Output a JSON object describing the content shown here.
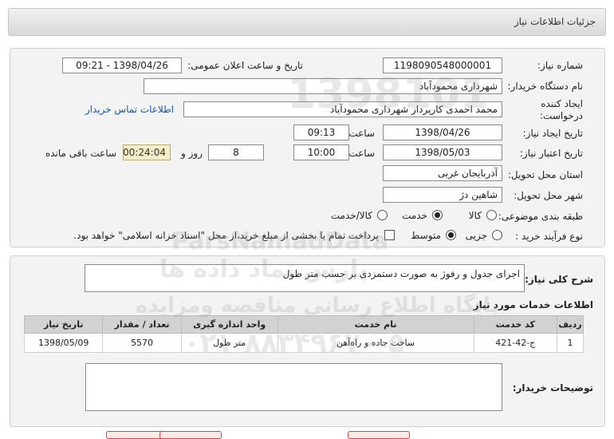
{
  "page": {
    "title": "جزئیات اطلاعات نیاز"
  },
  "form": {
    "need_number_label": "شماره نیاز:",
    "need_number": "1198090548000001",
    "announce_label": "تاریخ و ساعت اعلان عمومی:",
    "announce_value": "1398/04/26 - 09:21",
    "buyer_org_label": "نام دستگاه خریدار:",
    "buyer_org": "شهرداری محمودآباد",
    "creator_label": "ایجاد کننده درخواست:",
    "creator": "محمد احمدی کارپرداز شهرداری محمودآباد",
    "contact_link": "اطلاعات تماس خریدار",
    "created_date_label": "تاریخ ایجاد نیاز:",
    "created_date": "1398/04/26",
    "time_word": "ساعت",
    "created_time": "09:13",
    "validity_label": "تاریخ اعتبار نیاز:",
    "validity_date": "1398/05/03",
    "validity_time": "10:00",
    "days_value": "8",
    "day_and_label": "روز و",
    "remaining_time": "00:24:04",
    "remaining_label": "ساعت باقی مانده",
    "province_label": "استان محل تحویل:",
    "province": "آذربایجان غربی",
    "city_label": "شهر محل تحویل:",
    "city": "شاهین دژ",
    "category_label": "طبقه بندی موضوعی:",
    "category_options": [
      "کالا",
      "خدمت",
      "کالا/خدمت"
    ],
    "category_selected": "خدمت",
    "process_label": "نوع فرآیند خرید :",
    "process_options": [
      "جزیی",
      "متوسط"
    ],
    "process_selected": "متوسط",
    "payment_note": "پرداخت تمام یا بخشی از مبلغ خرید،از محل \"اسناد خزانه اسلامی\" خواهد بود."
  },
  "description": {
    "label": "شرح کلی نیاز:",
    "text": "اجرای جدول و  رفوژ به صورت دستمزدی بر حسب متر طول"
  },
  "services": {
    "title": "اطلاعات خدمات مورد نیاز",
    "columns": [
      "ردیف",
      "کد خدمت",
      "نام خدمت",
      "واحد اندازه گیری",
      "تعداد / مقدار",
      "تاریخ نیاز"
    ],
    "rows": [
      [
        "1",
        "ج-42-421",
        "ساخت جاده و راه‌آهن",
        "متر طول",
        "5570",
        "1398/05/09"
      ]
    ]
  },
  "buyer_notes": {
    "label": "توضیحات خریدار:",
    "text": ""
  },
  "watermark": {
    "line1": "ParsNamadData",
    "line2": "پارس نماد داده ها",
    "line3": "پایگاه اطلاع رسانی مناقصه ومزایده",
    "line4": "۰۲۱-۸۸۳۴۹۶۷۰-۵",
    "line5": "1398101"
  }
}
